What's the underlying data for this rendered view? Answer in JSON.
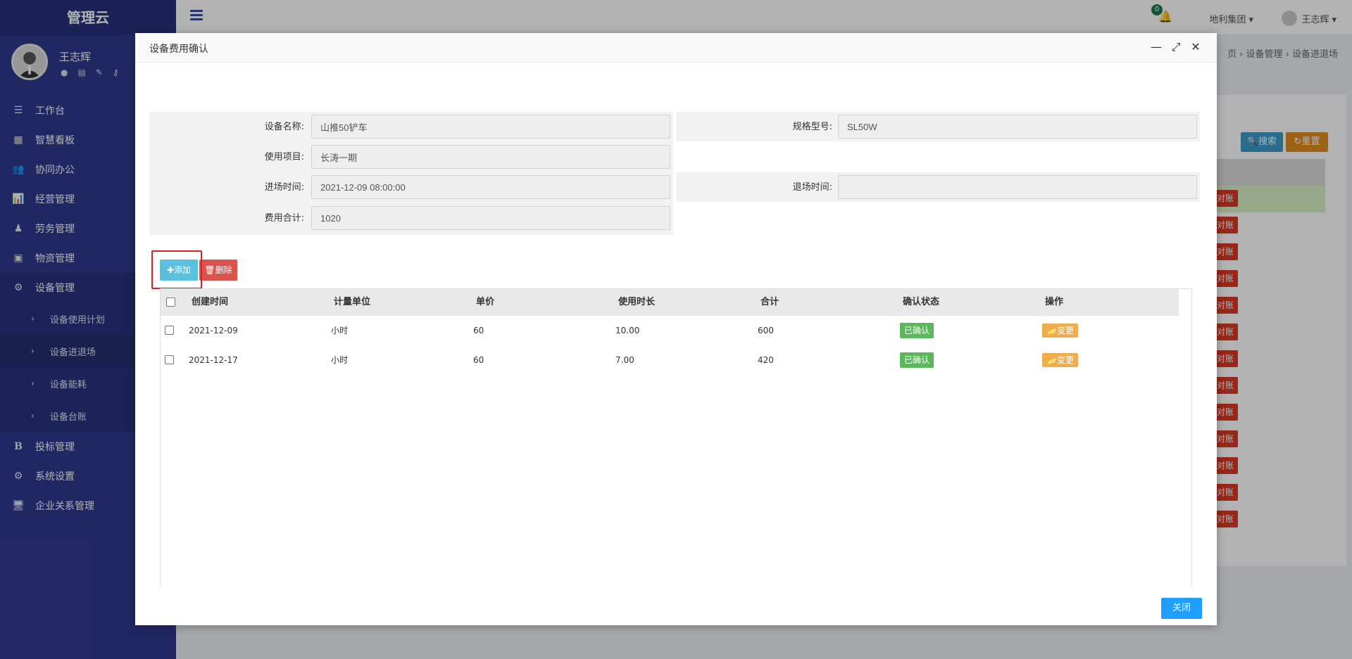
{
  "app": {
    "brand": "管理云"
  },
  "sidebar": {
    "user_name": "王志辉",
    "user_icons": [
      "user-icon",
      "id-card-icon",
      "edit-icon",
      "key-icon"
    ],
    "menu": [
      {
        "label": "工作台",
        "icon": "☰"
      },
      {
        "label": "智慧看板",
        "icon": "▦"
      },
      {
        "label": "协同办公",
        "icon": "👥"
      },
      {
        "label": "经营管理",
        "icon": "📊"
      },
      {
        "label": "劳务管理",
        "icon": "♟"
      },
      {
        "label": "物资管理",
        "icon": "▣"
      },
      {
        "label": "设备管理",
        "icon": "⚙"
      }
    ],
    "submenu": [
      {
        "label": "设备使用计划"
      },
      {
        "label": "设备进退场"
      },
      {
        "label": "设备能耗"
      },
      {
        "label": "设备台账"
      }
    ],
    "menu2": [
      {
        "label": "投标管理",
        "icon": "B"
      },
      {
        "label": "系统设置",
        "icon": "⚙"
      },
      {
        "label": "企业关系管理",
        "icon": "🖥"
      }
    ]
  },
  "topbar": {
    "notification_count": "0",
    "org": "地利集团 ▾",
    "user": "王志辉 ▾"
  },
  "breadcrumb": "页 › 设备管理 › 设备进退场",
  "background": {
    "search_label": "搜索",
    "reset_label": "重置",
    "reconcile_label": "对账"
  },
  "modal": {
    "title": "设备费用确认",
    "form": {
      "equipment_name_label": "设备名称:",
      "equipment_name": "山推50铲车",
      "model_label": "规格型号:",
      "model": "SL50W",
      "project_label": "使用项目:",
      "project": "长涛一期",
      "entry_time_label": "进场时间:",
      "entry_time": "2021-12-09 08:00:00",
      "exit_time_label": "退场时间:",
      "exit_time": "",
      "total_cost_label": "费用合计:",
      "total_cost": "1020"
    },
    "add_label": "添加",
    "delete_label": "删除",
    "table": {
      "headers": [
        "创建时间",
        "计量单位",
        "单价",
        "使用时长",
        "合计",
        "确认状态",
        "操作"
      ],
      "rows": [
        {
          "created": "2021-12-09",
          "unit": "小时",
          "price": "60",
          "duration": "10.00",
          "total": "600",
          "status": "已确认",
          "action": "变更"
        },
        {
          "created": "2021-12-17",
          "unit": "小时",
          "price": "60",
          "duration": "7.00",
          "total": "420",
          "status": "已确认",
          "action": "变更"
        }
      ]
    },
    "close_label": "关闭"
  }
}
